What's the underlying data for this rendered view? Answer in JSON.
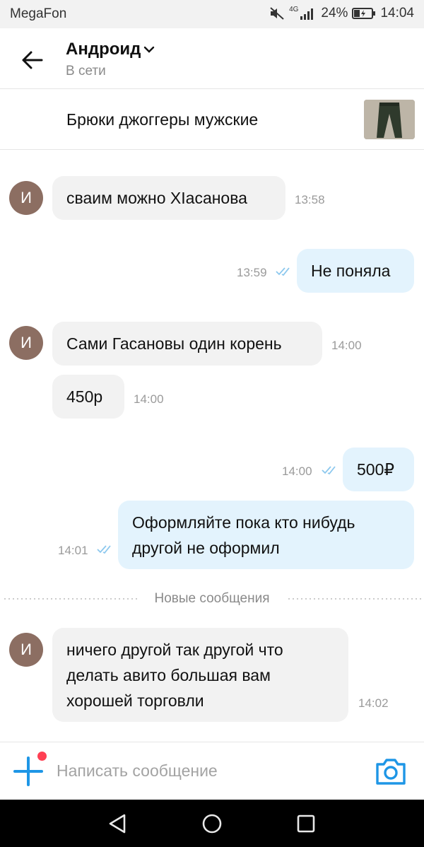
{
  "status_bar": {
    "carrier": "MegaFon",
    "network": "4G",
    "battery": "24%",
    "time": "14:04"
  },
  "header": {
    "title": "Андроид",
    "subtitle": "В сети",
    "icons": [
      "arrow-back-icon",
      "chevron-down-icon"
    ]
  },
  "product": {
    "name": "Брюки джоггеры мужские",
    "thumbnail": "pants-thumbnail"
  },
  "contact": {
    "avatar_letter": "И",
    "avatar_color": "#8c6e62"
  },
  "messages": [
    {
      "direction": "in",
      "text": "сваим можно ХIасанова",
      "time": "13:58"
    },
    {
      "direction": "out",
      "text": "Не поняла",
      "time": "13:59"
    },
    {
      "direction": "in",
      "text": "Сами Гасановы один корень",
      "time": "14:00"
    },
    {
      "direction": "in",
      "text": "450р",
      "time": "14:00"
    },
    {
      "direction": "out",
      "text": "500₽",
      "time": "14:00"
    },
    {
      "direction": "out",
      "text": "Оформляйте пока кто нибудь другой не оформил",
      "time": "14:01"
    },
    {
      "direction": "in",
      "text": "ничего другой так другой что делать авито большая вам хорошей торговли",
      "time": "14:02"
    }
  ],
  "divider": {
    "label": "Новые сообщения"
  },
  "input": {
    "placeholder": "Написать сообщение"
  },
  "colors": {
    "accent": "#1e96e6",
    "incoming_bubble": "#f2f2f2",
    "outgoing_bubble": "#e3f3fd",
    "notification_dot": "#ff4053",
    "read_ticks": "#8cc8ee"
  }
}
